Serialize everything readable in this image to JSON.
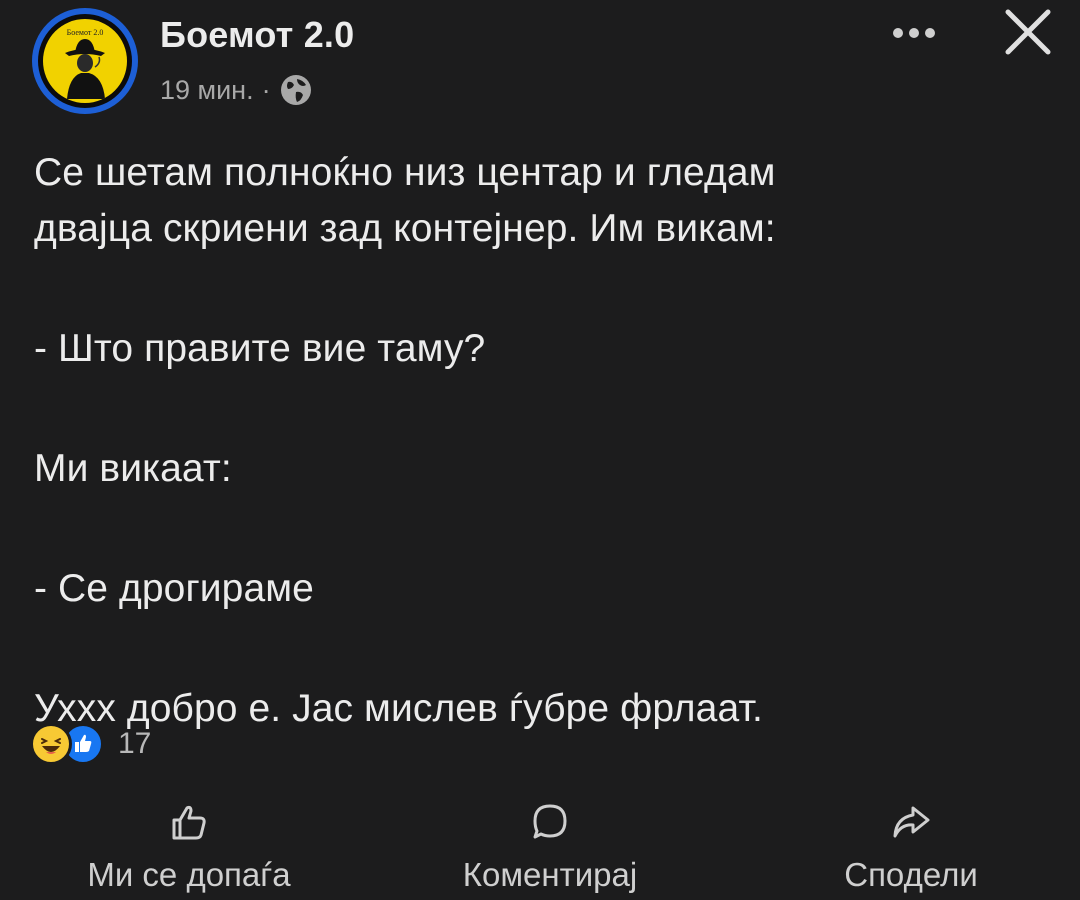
{
  "post": {
    "author": "Боемот 2.0",
    "avatar_text": "Боемот 2.0",
    "time": "19 мин.",
    "separator": "·",
    "audience_icon": "globe-icon",
    "lines": [
      "Се шетам полноќно низ центар и гледам",
      "двајца скриени зад контејнер. Им викам:",
      "",
      "- Што правите вие таму?",
      "",
      "Ми викаат:",
      "",
      "- Се дрогираме",
      "",
      "Ухxx добро е. Јас мислев ѓубре фрлаат."
    ]
  },
  "header": {
    "more_icon": "more-dots-icon",
    "close_icon": "close-icon"
  },
  "reactions": {
    "icons": [
      "haha-icon",
      "like-icon"
    ],
    "count": "17"
  },
  "actions": {
    "like_label": "Ми се допаѓа",
    "comment_label": "Коментирај",
    "share_label": "Сподели"
  },
  "colors": {
    "background": "#1c1c1d",
    "text": "#ececec",
    "secondary_text": "#a8a8a8",
    "avatar_ring": "#1d5fd6",
    "avatar_fill": "#f1d200",
    "like_blue": "#1877f2",
    "haha_yellow": "#f7c934"
  }
}
